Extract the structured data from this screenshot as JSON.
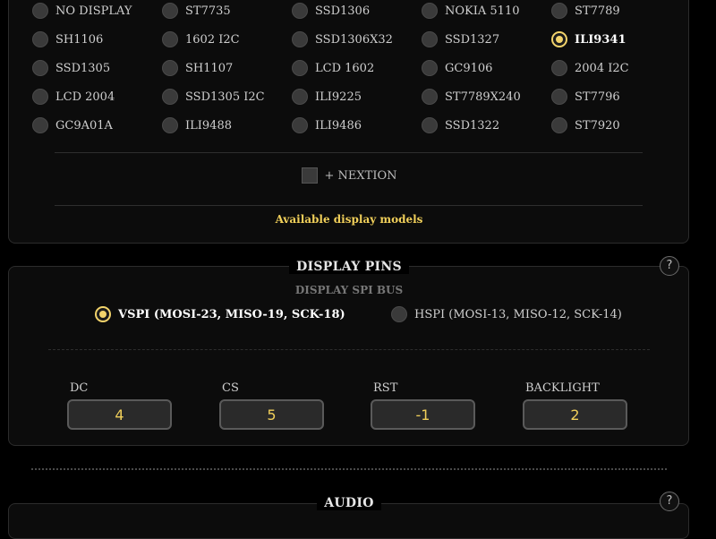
{
  "display_models": {
    "options": [
      "NO DISPLAY",
      "ST7735",
      "SSD1306",
      "NOKIA 5110",
      "ST7789",
      "SH1106",
      "1602 I2C",
      "SSD1306X32",
      "SSD1327",
      "ILI9341",
      "SSD1305",
      "SH1107",
      "LCD 1602",
      "GC9106",
      "2004 I2C",
      "LCD 2004",
      "SSD1305 I2C",
      "ILI9225",
      "ST7789X240",
      "ST7796",
      "GC9A01A",
      "ILI9488",
      "ILI9486",
      "SSD1322",
      "ST7920"
    ],
    "selected": "ILI9341",
    "nextion_label": "+ NEXTION",
    "nextion_checked": false,
    "caption": "Available display models"
  },
  "display_pins": {
    "title": "DISPLAY PINS",
    "help": "?",
    "bus_title": "DISPLAY SPI BUS",
    "bus_options": [
      {
        "label": "VSPI (MOSI-23, MISO-19, SCK-18)",
        "checked": true
      },
      {
        "label": "HSPI (MOSI-13, MISO-12, SCK-14)",
        "checked": false
      }
    ],
    "fields": [
      {
        "label": "DC",
        "value": "4"
      },
      {
        "label": "CS",
        "value": "5"
      },
      {
        "label": "RST",
        "value": "-1"
      },
      {
        "label": "BACKLIGHT",
        "value": "2"
      }
    ]
  },
  "audio": {
    "title": "AUDIO",
    "help": "?"
  },
  "colors": {
    "accent": "#f0cf5a",
    "background": "#000000",
    "panel": "#0c0c0c"
  }
}
